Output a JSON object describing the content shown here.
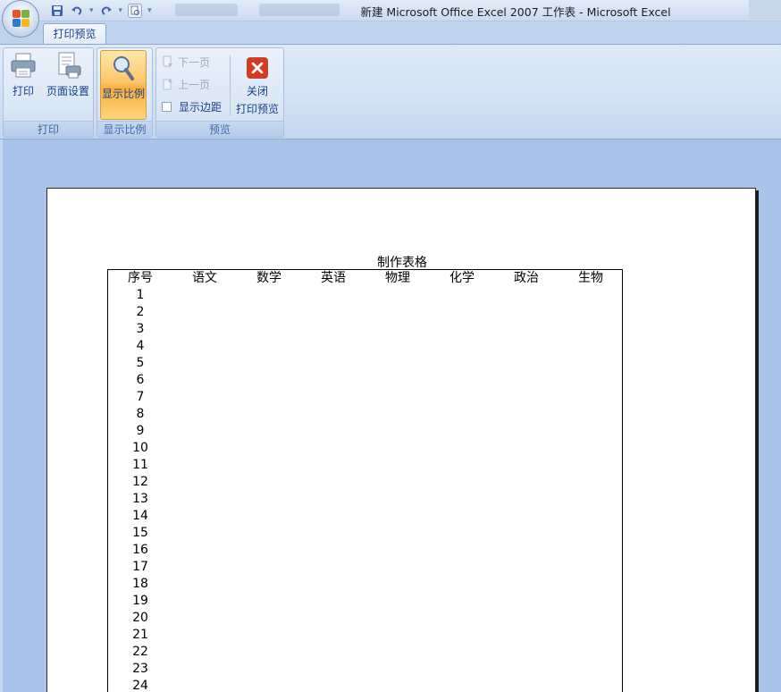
{
  "window": {
    "title": "新建 Microsoft Office Excel 2007 工作表 - Microsoft Excel"
  },
  "quick_access": {
    "icons": [
      "save-icon",
      "undo-icon",
      "redo-icon",
      "print-preview-icon",
      "customize-dropdown-icon"
    ]
  },
  "ribbon": {
    "tab_label": "打印预览",
    "groups": {
      "print": {
        "label": "打印",
        "print_button": "打印",
        "page_setup_button": "页面设置"
      },
      "zoom": {
        "label": "显示比例",
        "zoom_button": "显示比例"
      },
      "preview": {
        "label": "预览",
        "next_page": "下一页",
        "prev_page": "上一页",
        "show_margins": "显示边距",
        "close_line1": "关闭",
        "close_line2": "打印预览"
      }
    }
  },
  "sheet": {
    "title": "制作表格",
    "headers": [
      "序号",
      "语文",
      "数学",
      "英语",
      "物理",
      "化学",
      "政治",
      "生物"
    ],
    "row_numbers": [
      "1",
      "2",
      "3",
      "4",
      "5",
      "6",
      "7",
      "8",
      "9",
      "10",
      "11",
      "12",
      "13",
      "14",
      "15",
      "16",
      "17",
      "18",
      "19",
      "20",
      "21",
      "22",
      "23",
      "24"
    ]
  },
  "colors": {
    "ribbon_text": "#15428b",
    "workspace_bg": "#a9c4e8",
    "zoom_active": "#f9ad3c"
  }
}
